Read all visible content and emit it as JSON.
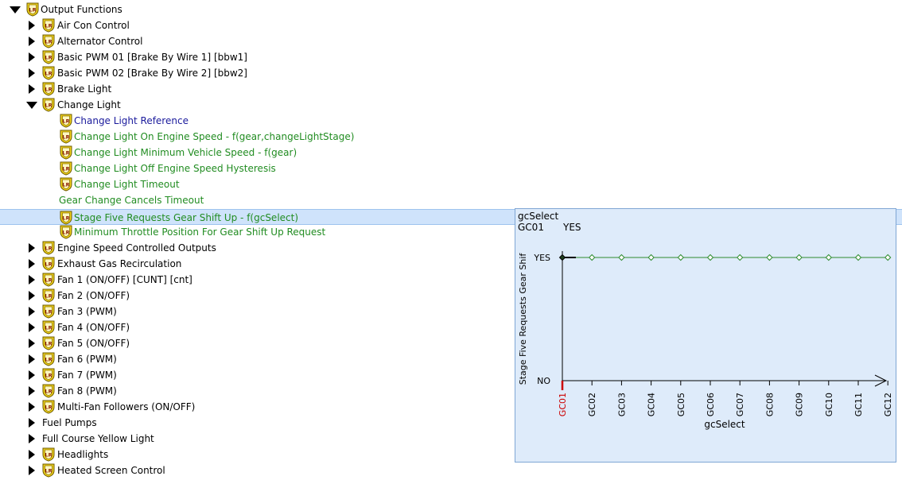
{
  "tree": {
    "root": {
      "label": "Output Functions",
      "expanded": true
    },
    "items": [
      {
        "label": "Air Con Control",
        "expanded": false
      },
      {
        "label": "Alternator Control",
        "expanded": false
      },
      {
        "label": "Basic PWM 01 [Brake By Wire 1] [bbw1]",
        "expanded": false
      },
      {
        "label": "Basic PWM 02 [Brake By Wire 2] [bbw2]",
        "expanded": false
      },
      {
        "label": "Brake Light",
        "expanded": false
      },
      {
        "label": "Change Light",
        "expanded": true,
        "children": [
          {
            "label": "Change Light Reference",
            "color": "blue"
          },
          {
            "label": "Change Light On Engine Speed - f(gear,changeLightStage)",
            "color": "green"
          },
          {
            "label": "Change Light Minimum Vehicle Speed - f(gear)",
            "color": "green"
          },
          {
            "label": "Change Light Off Engine Speed Hysteresis",
            "color": "green"
          },
          {
            "label": "Change Light Timeout",
            "color": "green"
          },
          {
            "label": "Gear Change Cancels Timeout",
            "color": "green"
          },
          {
            "label": "Stage Five Requests Gear Shift Up - f(gcSelect)",
            "color": "green",
            "selected": true
          },
          {
            "label": "Minimum Throttle Position For Gear Shift Up Request",
            "color": "green"
          }
        ]
      },
      {
        "label": "Engine Speed Controlled Outputs",
        "expanded": false
      },
      {
        "label": "Exhaust Gas Recirculation",
        "expanded": false
      },
      {
        "label": "Fan 1 (ON/OFF) [CUNT] [cnt]",
        "expanded": false
      },
      {
        "label": "Fan 2 (ON/OFF)",
        "expanded": false
      },
      {
        "label": "Fan 3 (PWM)",
        "expanded": false
      },
      {
        "label": "Fan 4 (ON/OFF)",
        "expanded": false
      },
      {
        "label": "Fan 5 (ON/OFF)",
        "expanded": false
      },
      {
        "label": "Fan 6 (PWM)",
        "expanded": false
      },
      {
        "label": "Fan 7 (PWM)",
        "expanded": false
      },
      {
        "label": "Fan 8 (PWM)",
        "expanded": false
      },
      {
        "label": "Multi-Fan Followers (ON/OFF)",
        "expanded": false
      },
      {
        "label": "Fuel Pumps",
        "expanded": false
      },
      {
        "label": "Full Course Yellow Light",
        "expanded": false
      },
      {
        "label": "Headlights",
        "expanded": false
      },
      {
        "label": "Heated Screen Control",
        "expanded": false
      }
    ]
  },
  "graph_panel": {
    "axis_variable": "gcSelect",
    "cursor_category": "GC01",
    "cursor_value": "YES",
    "xlabel": "gcSelect",
    "ylabel": "Stage Five Requests Gear Shif",
    "ytick_yes": "YES",
    "ytick_no": "NO"
  },
  "chart_data": {
    "type": "line",
    "categories": [
      "GC01",
      "GC02",
      "GC03",
      "GC04",
      "GC05",
      "GC06",
      "GC07",
      "GC08",
      "GC09",
      "GC10",
      "GC11",
      "GC12"
    ],
    "y_levels": [
      "NO",
      "YES"
    ],
    "values": [
      "YES",
      "YES",
      "YES",
      "YES",
      "YES",
      "YES",
      "YES",
      "YES",
      "YES",
      "YES",
      "YES",
      "YES"
    ],
    "selected_index": 0,
    "xlabel": "gcSelect",
    "ylabel": "Stage Five Requests Gear Shif",
    "grid": false,
    "colors": {
      "line": "#2e8b2e",
      "selected_tick": "#cc0000",
      "background": "#deebfa"
    }
  }
}
